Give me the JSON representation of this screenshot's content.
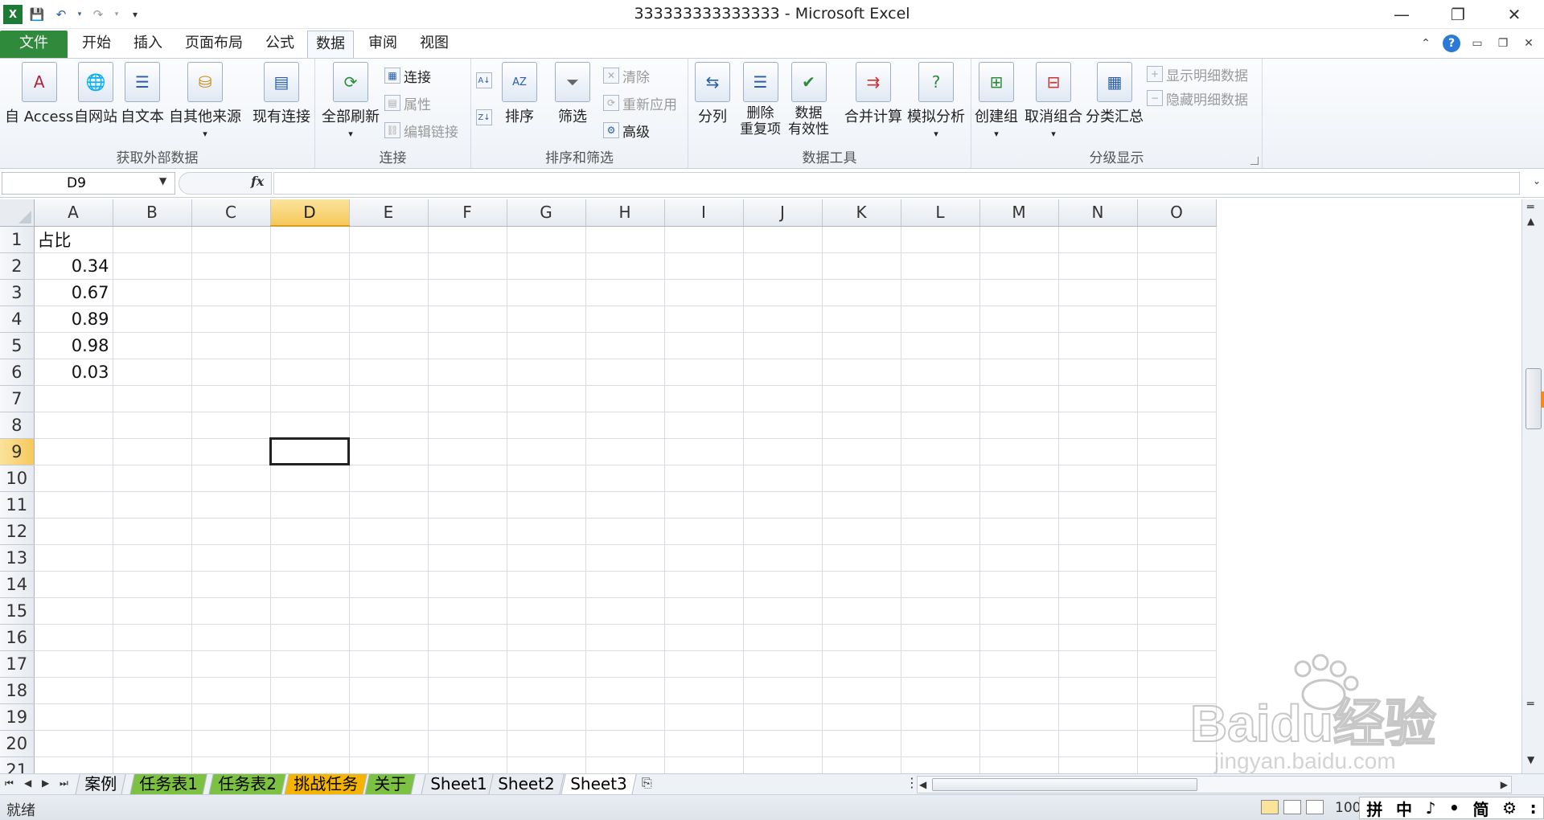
{
  "app": {
    "window_title": "333333333333333 - Microsoft Excel"
  },
  "ribbon_tabs": [
    {
      "label": "文件",
      "active": false,
      "is_file": true
    },
    {
      "label": "开始",
      "active": false
    },
    {
      "label": "插入",
      "active": false
    },
    {
      "label": "页面布局",
      "active": false
    },
    {
      "label": "公式",
      "active": false
    },
    {
      "label": "数据",
      "active": true
    },
    {
      "label": "审阅",
      "active": false
    },
    {
      "label": "视图",
      "active": false
    }
  ],
  "ribbon": {
    "groups": {
      "external_data": {
        "label": "获取外部数据",
        "buttons": [
          "自 Access",
          "自网站",
          "自文本",
          "自其他来源",
          "现有连接"
        ]
      },
      "connections": {
        "label": "连接",
        "refresh_all": "全部刷新",
        "connections": "连接",
        "properties": "属性",
        "edit_links": "编辑链接"
      },
      "sort_filter": {
        "label": "排序和筛选",
        "sort": "排序",
        "filter": "筛选",
        "clear": "清除",
        "reapply": "重新应用",
        "advanced": "高级"
      },
      "data_tools": {
        "label": "数据工具",
        "text_to_columns": "分列",
        "remove_dup_1": "删除",
        "remove_dup_2": "重复项",
        "validation_1": "数据",
        "validation_2": "有效性",
        "consolidate": "合并计算",
        "what_if": "模拟分析"
      },
      "outline": {
        "label": "分级显示",
        "group": "创建组",
        "ungroup": "取消组合",
        "subtotal": "分类汇总",
        "show_detail": "显示明细数据",
        "hide_detail": "隐藏明细数据"
      }
    }
  },
  "formula_bar": {
    "name_box": "D9",
    "fx": "fx",
    "content": ""
  },
  "sheet": {
    "columns": [
      "A",
      "B",
      "C",
      "D",
      "E",
      "F",
      "G",
      "H",
      "I",
      "J",
      "K",
      "L",
      "M",
      "N",
      "O"
    ],
    "selected_column": "D",
    "selected_row": 9,
    "rows": [
      {
        "n": "1",
        "a": "占比"
      },
      {
        "n": "2",
        "a": "0.34"
      },
      {
        "n": "3",
        "a": "0.67"
      },
      {
        "n": "4",
        "a": "0.89"
      },
      {
        "n": "5",
        "a": "0.98"
      },
      {
        "n": "6",
        "a": "0.03"
      },
      {
        "n": "7",
        "a": ""
      },
      {
        "n": "8",
        "a": ""
      },
      {
        "n": "9",
        "a": ""
      },
      {
        "n": "10",
        "a": ""
      },
      {
        "n": "11",
        "a": ""
      },
      {
        "n": "12",
        "a": ""
      },
      {
        "n": "13",
        "a": ""
      },
      {
        "n": "14",
        "a": ""
      },
      {
        "n": "15",
        "a": ""
      },
      {
        "n": "16",
        "a": ""
      },
      {
        "n": "17",
        "a": ""
      },
      {
        "n": "18",
        "a": ""
      },
      {
        "n": "19",
        "a": ""
      },
      {
        "n": "20",
        "a": ""
      },
      {
        "n": "21",
        "a": ""
      }
    ]
  },
  "sheet_tabs": [
    {
      "label": "案例",
      "color": "#e8ecf1",
      "active": false
    },
    {
      "label": "任务表1",
      "color": "#7cc142",
      "active": false
    },
    {
      "label": "任务表2",
      "color": "#7cc142",
      "active": false
    },
    {
      "label": "挑战任务",
      "color": "#f5b400",
      "active": false
    },
    {
      "label": "关于",
      "color": "#7cc142",
      "active": false
    },
    {
      "label": "Sheet1",
      "color": "#e8ecf1",
      "active": false
    },
    {
      "label": "Sheet2",
      "color": "#e8ecf1",
      "active": false
    },
    {
      "label": "Sheet3",
      "color": "#ffffff",
      "active": true
    }
  ],
  "status": {
    "ready": "就绪",
    "zoom": "100",
    "ime": [
      "拼",
      "中",
      "♪",
      "•",
      "简",
      "⚙",
      ":"
    ]
  },
  "watermark": {
    "brand": "Baidu经验",
    "url": "jingyan.baidu.com"
  }
}
